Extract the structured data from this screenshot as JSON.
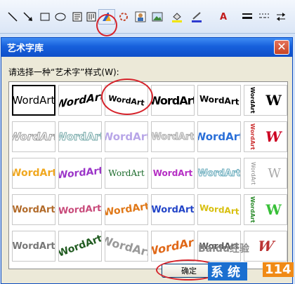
{
  "toolbar": {
    "icons": [
      "line-tool-icon",
      "arrow-tool-icon",
      "rectangle-tool-icon",
      "oval-tool-icon",
      "text-box-icon",
      "vertical-text-box-icon",
      "wordart-icon",
      "diagram-icon",
      "clip-art-icon",
      "picture-icon",
      "fill-color-icon",
      "line-color-icon",
      "font-color-icon",
      "line-style-icon",
      "dash-style-icon",
      "arrow-style-icon"
    ],
    "font_color_glyph": "A"
  },
  "dialog": {
    "title": "艺术字库",
    "close_glyph": "✕",
    "prompt": "请选择一种“艺术字”样式(W):",
    "ok_label": "确定",
    "wordart_text": "WordArt",
    "vertical_text": "WordArt",
    "w_glyph": "W"
  },
  "watermark": {
    "baidu": "Baidu经验",
    "site": "系统",
    "number": "114"
  },
  "colors": {
    "title_blue": "#1760dc",
    "highlight_red": "#d6242c",
    "watermark_blue": "#1b6fd0",
    "watermark_orange": "#f08a16"
  }
}
